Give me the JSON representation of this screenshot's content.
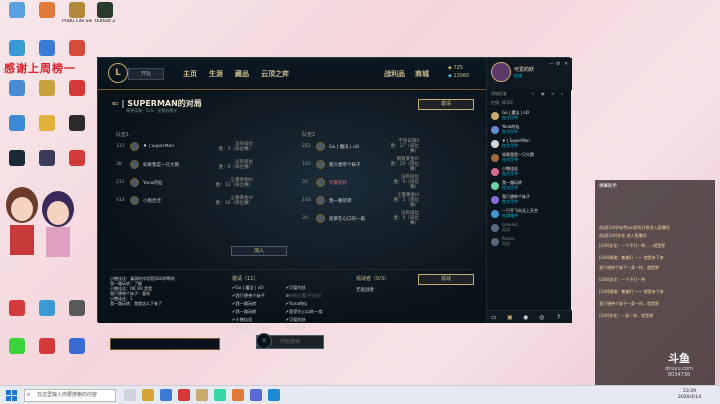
{
  "desktop": {
    "overlay_text": "感谢上周榜一",
    "icons": [
      {
        "label": "",
        "color": "#3a7bd5"
      },
      {
        "label": "",
        "color": "#e05a2a"
      },
      {
        "label": "PUBG Lite Server",
        "color": "#7a6a2a"
      },
      {
        "label": "Outlast 2",
        "color": "#3a4a3a"
      },
      {
        "label": "",
        "color": "#3a9ad5"
      },
      {
        "label": "",
        "color": "#d53a3a"
      },
      {
        "label": "",
        "color": "#d5a53a"
      },
      {
        "label": "",
        "color": "#2a2a2a"
      }
    ]
  },
  "client": {
    "logo": "L",
    "play_label": "开始",
    "nav": [
      "主页",
      "生涯",
      "藏品",
      "云顶之弈"
    ],
    "nav_right": [
      "战利品",
      "商城"
    ],
    "blue_essence": "725",
    "riot_points": "13960",
    "lobby_title": "| SUPERMAN的对局",
    "lobby_sub": "嚎哭深渊 · 5v5 · 全随机模式",
    "invite_label": "邀请",
    "team1_header": "队伍1",
    "team2_header": "队伍2",
    "team1": [
      {
        "level": "131",
        "name": "♦ | SuperMan",
        "rank": "没有排位",
        "rank2": "胜：0（排位赛）"
      },
      {
        "level": "38",
        "name": "如果我是一只大鹅",
        "rank": "没有排位",
        "rank2": "胜：0（排位赛）"
      },
      {
        "level": "212",
        "name": "Yona的仙",
        "rank": "尘暴青铜IV",
        "rank2": "胜：12（排位赛）"
      },
      {
        "level": "414",
        "name": "小鲍佳佳",
        "rank": "尘暴黄金IV",
        "rank2": "胜：16（排位赛）"
      }
    ],
    "team2": [
      {
        "level": "222",
        "name": "Go | 魔法 | oO",
        "rank": "不屈白银II",
        "rank2": "胜：27（排位赛）"
      },
      {
        "level": "103",
        "name": "我只想带个妹子",
        "rank": "钢铁黄金IV",
        "rank2": "胜：20（排位赛）"
      },
      {
        "level": "35",
        "name": "可爱的妖",
        "rank": "没有排位",
        "rank2": "胜：0（排位赛）"
      },
      {
        "level": "103",
        "name": "我一路玩转",
        "rank": "尘暴黄金III",
        "rank2": "胜：5（排位赛）"
      },
      {
        "level": "30",
        "name": "菠萝在心口的一扇",
        "rank": "没有排位",
        "rank2": "胜：0（排位赛）"
      }
    ],
    "join_label": "加入",
    "chat_lines": [
      "小鲍佳佳：漏洞的作用是QBG你啊的",
      "我一路玩转：了解",
      "小鲍佳佳：OK OK 是是",
      "我只想带个妹子：喜哈",
      "小鲍佳佳：1",
      "我一路玩转：我就这么下来了"
    ],
    "ready_header": "邀请（11）",
    "ready_list": [
      {
        "a": "Go | 魔法 | oO",
        "b": "可爱的妖"
      },
      {
        "a": "我只想带个妹子",
        "b": "所有位置(不可选)"
      },
      {
        "a": "我一路玩转",
        "b": "Yona的仙"
      },
      {
        "a": "我一路玩转",
        "b": "菠萝在心口的一扇"
      },
      {
        "a": "小鲍佳佳",
        "b": "可爱的妖"
      },
      {
        "a": "如果我是一只大鹅",
        "b": "可爱的妖"
      }
    ],
    "spectator_header": "观战者（0/3）",
    "spectator_sub": "无观战者",
    "spectator_btn": "观战",
    "start_label": "开始游戏"
  },
  "social": {
    "username": "可爱的妖",
    "status": "在线",
    "bar_label": "添加好友",
    "online_header": "在线（8/15）",
    "friends": [
      {
        "name": "Go | 魔法 | oO",
        "status": "在大厅中",
        "color": "#c8aa6e"
      },
      {
        "name": "Yona的仙",
        "status": "在大厅中",
        "color": "#6a8ad5"
      },
      {
        "name": "♦ | SuperMan",
        "status": "在大厅中",
        "color": "#d5d5d5"
      },
      {
        "name": "如果我是一只大鹅",
        "status": "在大厅中",
        "color": "#a56a3a"
      },
      {
        "name": "小鲍佳佳",
        "status": "在大厅中",
        "color": "#d56a8a"
      },
      {
        "name": "我一路玩转",
        "status": "在大厅中",
        "color": "#6ad5a5"
      },
      {
        "name": "我只想带个妹子",
        "status": "在大厅中",
        "color": "#8a6ad5"
      },
      {
        "name": "一只平飞向无上天空",
        "status": "在游戏中",
        "color": "#3a9ad5"
      },
      {
        "name": "Leavess",
        "status": "离线",
        "color": "#5a6a7a"
      },
      {
        "name": "Raven",
        "status": "离线",
        "color": "#5a6a7a"
      }
    ]
  },
  "danmu": {
    "header": "弹幕助手",
    "lines": [
      "欢迎[LV8]Aqiffyoo家的日常进入直播间",
      "欢迎[LV8]花花 进入直播间",
      "[LV8]花花：一个不打一种……就是那",
      "[LV8]情绪：集美们 —— 就是有下来",
      "我只想带个妹子一身一样，就是那",
      "[LV8]花花：一个不打一种",
      "[LV8]情绪：集美们 —— 就是有下来",
      "我只想带个妹子一身一样，就是那",
      "[LV8]花花：一身一样，就是那"
    ],
    "brand": "斗鱼",
    "brand_sub": "douyu.com",
    "room": "8034736"
  },
  "taskbar": {
    "search_placeholder": "在这里输入你要搜索的内容",
    "time": "23:29",
    "date": "2020/4/14"
  }
}
